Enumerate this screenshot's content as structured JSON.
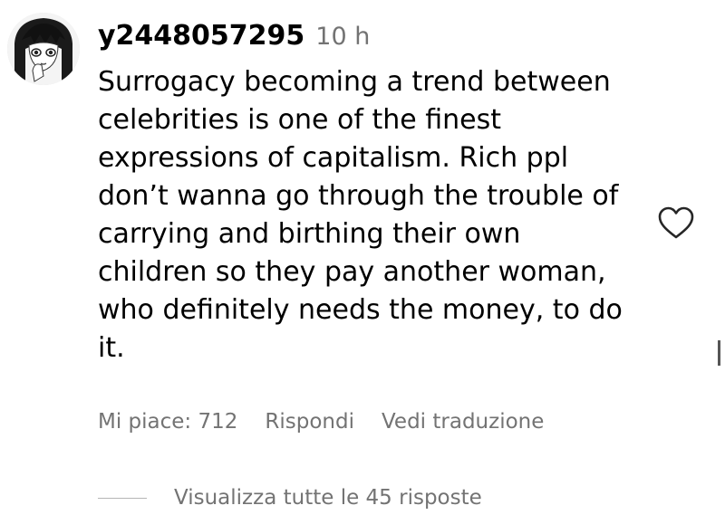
{
  "comment": {
    "username": "y2448057295",
    "timestamp": "10 h",
    "avatar_icon": "manga-girl-avatar",
    "text_lines": [
      "Surrogacy becoming a trend between",
      "celebrities is one of the finest",
      "expressions of capitalism. Rich ppl",
      "don’t wanna go through the trouble of",
      "carrying and birthing their own",
      "children so they pay another woman,",
      "who definitely needs the money, to do",
      "it."
    ],
    "like_icon": "heart-outline-icon"
  },
  "actions": {
    "likes": "Mi piace: 712",
    "reply": "Rispondi",
    "translate": "Vedi traduzione"
  },
  "replies": {
    "view_all": "Visualizza tutte le 45 risposte"
  },
  "colors": {
    "text": "#000000",
    "muted": "#737373",
    "rule": "#b5b5b5",
    "background": "#ffffff"
  }
}
